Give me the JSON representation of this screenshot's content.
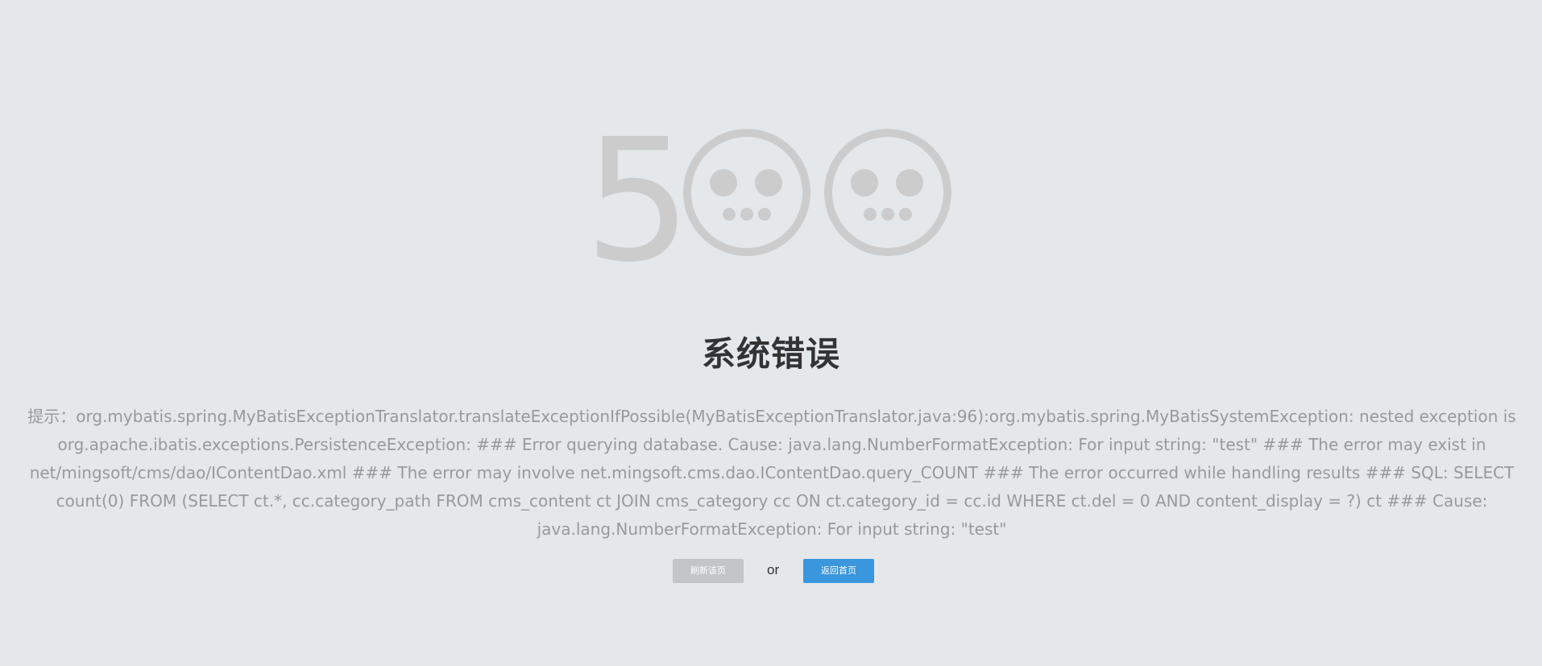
{
  "error_code_digit": "5",
  "title": "系统错误",
  "message": "提示：org.mybatis.spring.MyBatisExceptionTranslator.translateExceptionIfPossible(MyBatisExceptionTranslator.java:96):org.mybatis.spring.MyBatisSystemException: nested exception is org.apache.ibatis.exceptions.PersistenceException: ### Error querying database. Cause: java.lang.NumberFormatException: For input string: \"test\" ### The error may exist in net/mingsoft/cms/dao/IContentDao.xml ### The error may involve net.mingsoft.cms.dao.IContentDao.query_COUNT ### The error occurred while handling results ### SQL: SELECT count(0) FROM (SELECT ct.*, cc.category_path FROM cms_content ct JOIN cms_category cc ON ct.category_id = cc.id WHERE ct.del = 0 AND content_display = ?) ct ### Cause: java.lang.NumberFormatException: For input string: \"test\"",
  "actions": {
    "refresh_label": "刷新该页",
    "separator": "or",
    "home_label": "返回首页"
  },
  "colors": {
    "background": "#e4e8eb",
    "graphic": "#cccccc",
    "title": "#333333",
    "message": "#999999",
    "refresh_button": "#c2c6c9",
    "home_button": "#3a96dd"
  },
  "icons": [
    "sad-face-icon",
    "sad-face-icon"
  ]
}
